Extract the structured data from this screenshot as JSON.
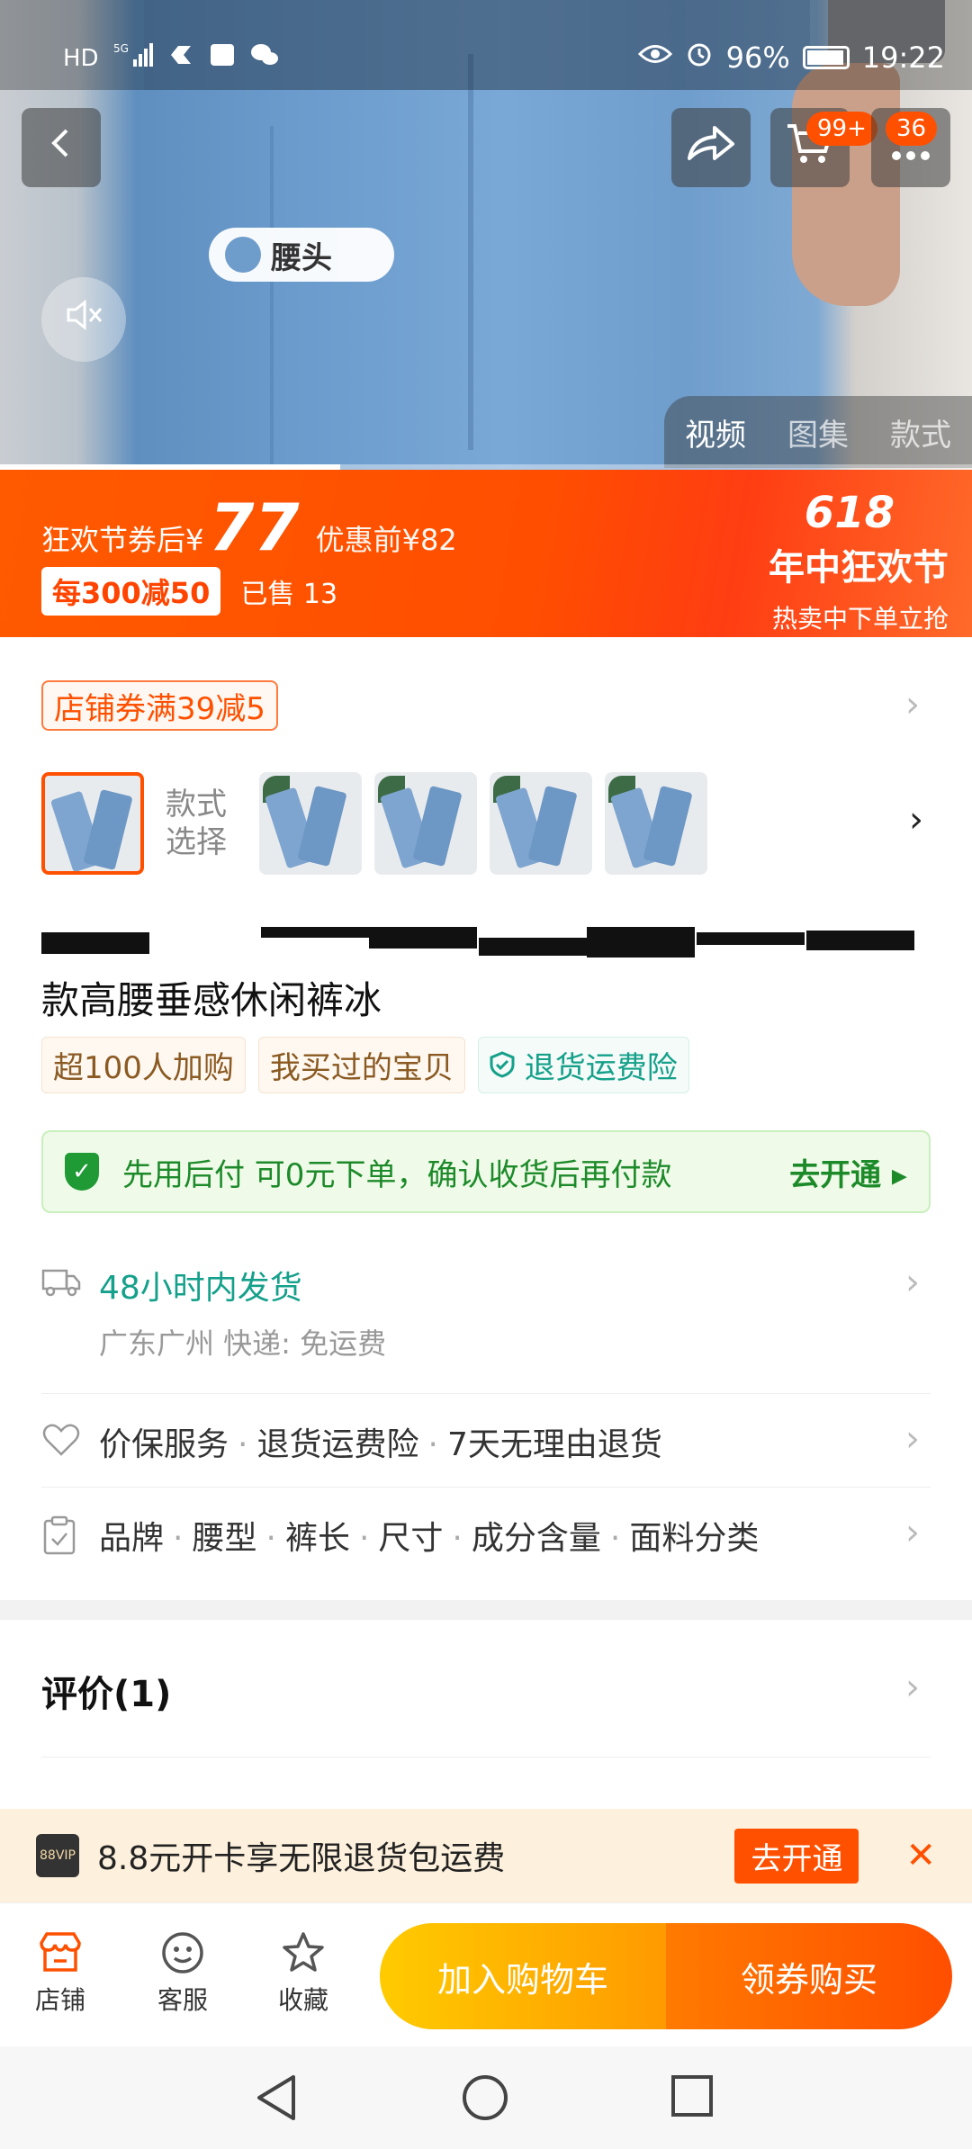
{
  "status_bar": {
    "left_icons": [
      "HD",
      "5G"
    ],
    "battery": "96%",
    "time": "19:22"
  },
  "top_actions": {
    "cart_badge": "99+",
    "messages_badge": "36"
  },
  "media": {
    "overlay_label": "腰头",
    "tabs": [
      "视频",
      "图集",
      "款式"
    ],
    "active_tab": "视频",
    "progress": 0.35
  },
  "promo": {
    "price_label": "狂欢节券后",
    "currency": "¥",
    "price": "77",
    "original_price": "优惠前¥82",
    "coupon": "每300减50",
    "sold": "已售 13",
    "event_number": "618",
    "event_name": "年中狂欢节",
    "event_sub": "热卖中下单立抢"
  },
  "shop_coupon": "店铺券满39减5",
  "style_select": {
    "label_line1": "款式",
    "label_line2": "选择",
    "thumb_count": 5
  },
  "product": {
    "title": "款高腰垂感休闲裤冰",
    "tags": [
      "超100人加购",
      "我买过的宝贝",
      "退货运费险"
    ]
  },
  "pay_later": {
    "text": "先用后付  可0元下单，确认收货后再付款",
    "action": "去开通 ▸"
  },
  "shipping": {
    "title": "48小时内发货",
    "detail": "广东广州  快递: 免运费"
  },
  "service": {
    "items": [
      "价保服务",
      "退货运费险",
      "7天无理由退货"
    ]
  },
  "params": {
    "items": [
      "品牌",
      "腰型",
      "裤长",
      "尺寸",
      "成分含量",
      "面料分类"
    ]
  },
  "reviews": {
    "label": "评价(1)"
  },
  "vip": {
    "logo": "88VIP",
    "text": "8.8元开卡享无限退货包运费",
    "action": "去开通",
    "close": "✕"
  },
  "bottom_bar": {
    "shop": "店铺",
    "service": "客服",
    "favorite": "收藏",
    "add_cart": "加入购物车",
    "buy": "领券购买"
  },
  "colors": {
    "accent": "#ff5000",
    "promo_bg": "#ff4e00",
    "green": "#1d8a2a",
    "teal": "#14a08a"
  }
}
